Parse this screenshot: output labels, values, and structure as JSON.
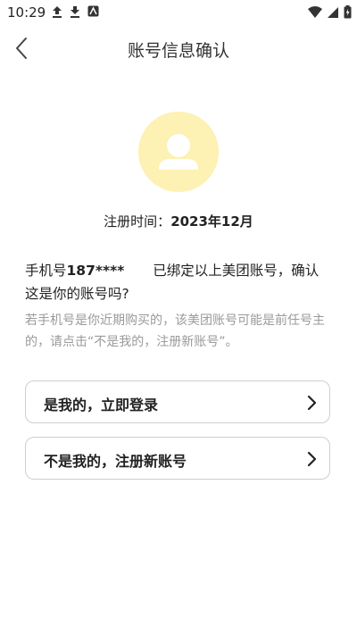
{
  "status_bar": {
    "time": "10:29",
    "icons": [
      "upload-icon",
      "download-icon",
      "app-notification-icon",
      "wifi-icon",
      "signal-icon",
      "battery-icon"
    ]
  },
  "header": {
    "title": "账号信息确认",
    "back_icon": "chevron-left-icon"
  },
  "profile": {
    "avatar_icon": "user-avatar-icon",
    "avatar_color": "#fdf1b3",
    "reg_label": "注册时间：",
    "reg_value": "2023年12月"
  },
  "message": {
    "prefix": "手机号",
    "phone_masked": "187****",
    "suffix": "已绑定以上美团账号，确认这是你的账号吗?",
    "hint": "若手机号是你近期购买的，该美团账号可能是前任号主的，请点击“不是我的，注册新账号”。"
  },
  "options": [
    {
      "label": "是我的，立即登录",
      "icon": "chevron-right-icon"
    },
    {
      "label": "不是我的，注册新账号",
      "icon": "chevron-right-icon"
    }
  ]
}
